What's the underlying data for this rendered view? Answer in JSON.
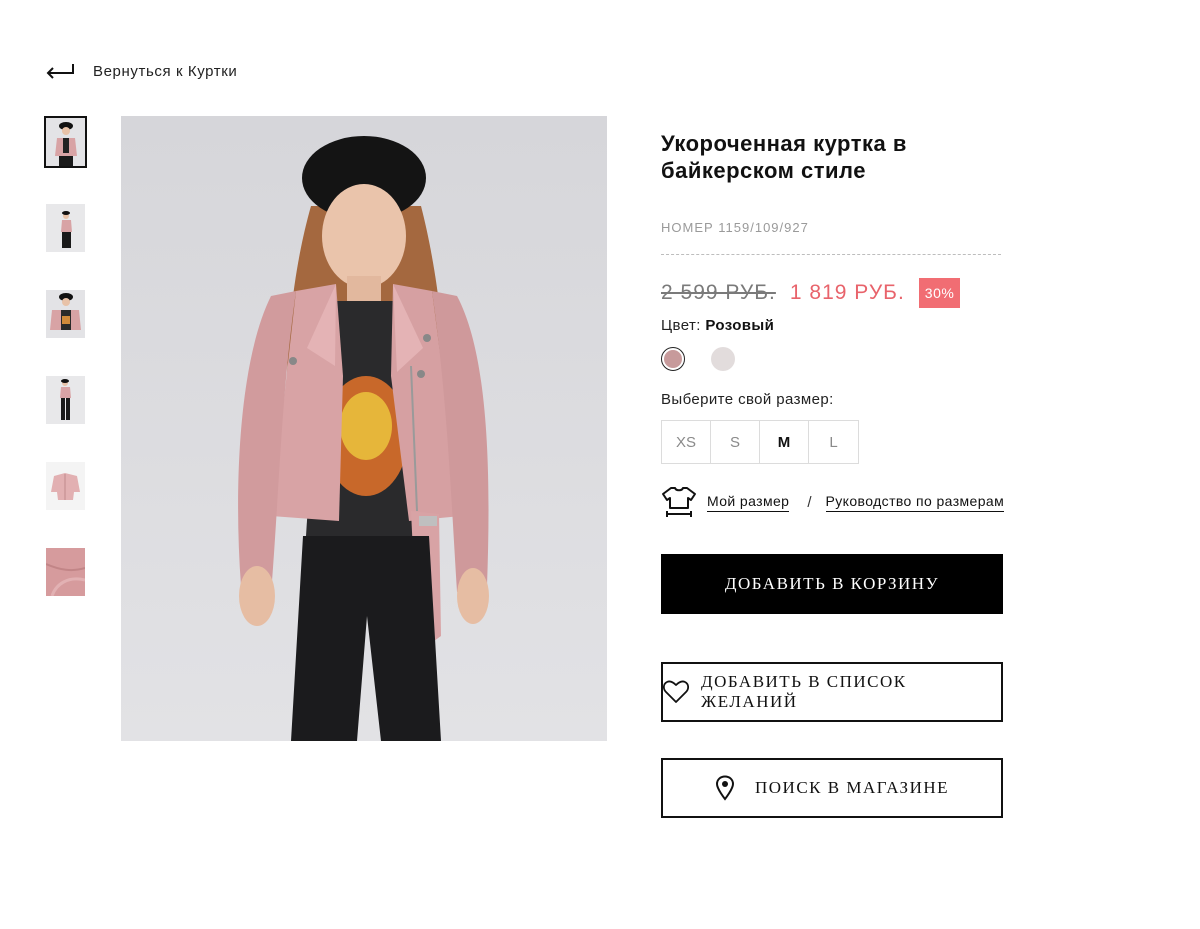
{
  "back": {
    "label": "Вернуться к Куртки",
    "icon": "return-arrow-icon"
  },
  "product": {
    "title": "Укороченная куртка в байкерском стиле",
    "sku": "НОМЕР 1159/109/927",
    "old_price": "2 599 РУБ.",
    "new_price": "1 819 РУБ.",
    "discount": "30%",
    "color_label": "Цвет:",
    "color_value": "Розовый",
    "colors": [
      {
        "name": "Розовый",
        "hex": "#c79a9b",
        "selected": true
      },
      {
        "name": "Светлый",
        "hex": "#e2dcdc",
        "selected": false
      }
    ],
    "size_label": "Выберите свой размер:",
    "sizes": [
      {
        "label": "XS",
        "selected": false
      },
      {
        "label": "S",
        "selected": false
      },
      {
        "label": "M",
        "selected": true
      },
      {
        "label": "L",
        "selected": false
      }
    ],
    "my_size": "Мой размер",
    "separator": "/",
    "size_guide": "Руководство по размерам"
  },
  "buttons": {
    "add_to_cart": "ДОБАВИТЬ В КОРЗИНУ",
    "add_to_wishlist": "ДОБАВИТЬ В СПИСОК ЖЕЛАНИЙ",
    "find_in_store": "ПОИСК В МАГАЗИНЕ"
  },
  "colors": {
    "sale": "#e8636b",
    "discount_badge": "#f16d73",
    "primary_button": "#000000",
    "jacket": "#d8a3a5",
    "photo_background": "#d9d9dd"
  },
  "thumbnails": [
    {
      "name": "front-view",
      "active": true
    },
    {
      "name": "side-view",
      "active": false
    },
    {
      "name": "open-jacket",
      "active": false
    },
    {
      "name": "full-length",
      "active": false
    },
    {
      "name": "flat-lay",
      "active": false
    },
    {
      "name": "leather-detail",
      "active": false
    }
  ]
}
